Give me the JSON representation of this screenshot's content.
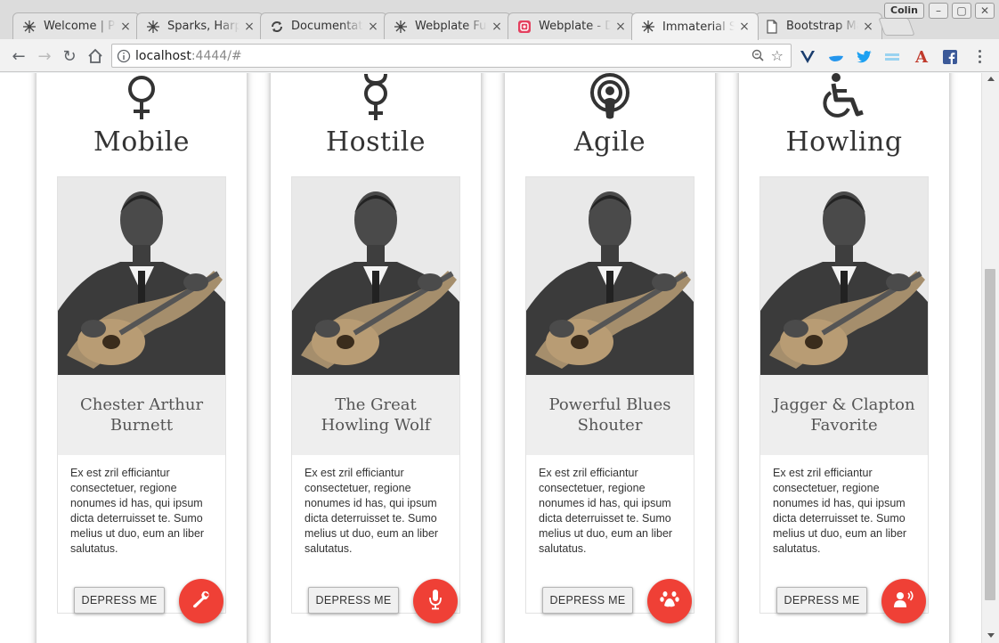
{
  "browser": {
    "tabs": [
      {
        "title": "Welcome | Pl",
        "icon": "snowflake-icon"
      },
      {
        "title": "Sparks, Harp",
        "icon": "snowflake-icon"
      },
      {
        "title": "Documentat",
        "icon": "sync-icon"
      },
      {
        "title": "Webplate Fu",
        "icon": "snowflake-icon"
      },
      {
        "title": "Webplate - D",
        "icon": "instagram-icon"
      },
      {
        "title": "Immaterial S",
        "icon": "snowflake-icon",
        "active": true
      },
      {
        "title": "Bootstrap Ma",
        "icon": "page-icon"
      }
    ],
    "profile_name": "Colin",
    "url_host": "localhost",
    "url_rest": ":4444/#"
  },
  "cards": [
    {
      "title": "Mobile",
      "symbol": "venus-icon",
      "subtitle": "Chester Arthur Burnett",
      "body": "Ex est zril efficiantur consectetuer, regione nonumes id has, qui ipsum dicta deterruisset te. Sumo melius ut duo, eum an liber salutatus.",
      "button": "DEPRESS ME",
      "fab_icon": "wrench-icon"
    },
    {
      "title": "Hostile",
      "symbol": "mercury-icon",
      "subtitle": "The Great Howling Wolf",
      "body": "Ex est zril efficiantur consectetuer, regione nonumes id has, qui ipsum dicta deterruisset te. Sumo melius ut duo, eum an liber salutatus.",
      "button": "DEPRESS ME",
      "fab_icon": "microphone-icon"
    },
    {
      "title": "Agile",
      "symbol": "podcast-icon",
      "subtitle": "Powerful Blues Shouter",
      "body": "Ex est zril efficiantur consectetuer, regione nonumes id has, qui ipsum dicta deterruisset te. Sumo melius ut duo, eum an liber salutatus.",
      "button": "DEPRESS ME",
      "fab_icon": "paw-icon"
    },
    {
      "title": "Howling",
      "symbol": "wheelchair-icon",
      "subtitle": "Jagger & Clapton Favorite",
      "body": "Ex est zril efficiantur consectetuer, regione nonumes id has, qui ipsum dicta deterruisset te. Sumo melius ut duo, eum an liber salutatus.",
      "button": "DEPRESS ME",
      "fab_icon": "speaking-person-icon"
    }
  ],
  "colors": {
    "fab": "#ef4036",
    "subtitle_bg": "#eeeeee"
  }
}
